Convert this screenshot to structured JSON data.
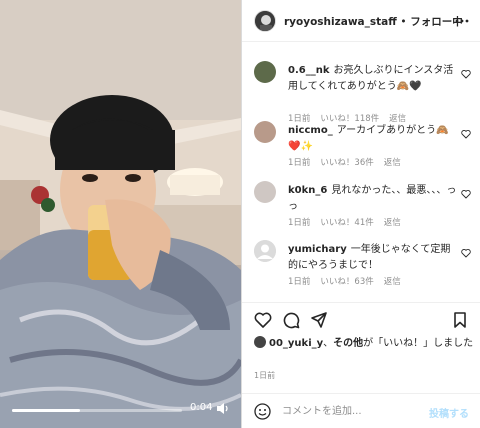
{
  "video": {
    "time": "0:04",
    "progress": 0.4,
    "volume_icon": "volume-icon"
  },
  "header": {
    "username": "ryoyoshizawa_staff",
    "separator": "•",
    "follow_status": "フォロー中",
    "more_icon": "more-icon"
  },
  "comments": [
    {
      "user": "0.6__nk",
      "text": "お亮久しぶりにインスタ活用してくれてありがとう🙈🖤",
      "time": "1日前",
      "likes": "いいね！118件",
      "reply": "返信"
    },
    {
      "user": "niccmo_",
      "text": "アーカイブありがとう🙈❤️✨",
      "time": "1日前",
      "likes": "いいね！36件",
      "reply": "返信"
    },
    {
      "user": "k0kn_6",
      "text": "見れなかった、、最悪、、、っっ",
      "time": "1日前",
      "likes": "いいね！41件",
      "reply": "返信"
    },
    {
      "user": "yumichary",
      "text": "一年後じゃなくて定期的にやろうまじで！",
      "time": "1日前",
      "likes": "いいね！63件",
      "reply": "返信"
    }
  ],
  "actions": {
    "like_icon": "heart-icon",
    "comment_icon": "comment-icon",
    "share_icon": "send-icon",
    "save_icon": "bookmark-icon"
  },
  "likes_line": {
    "liker": "00_yuki_y",
    "connector": "、",
    "others": "その他",
    "suffix": "が「いいね！」しました"
  },
  "post_date": "1日前",
  "comment_bar": {
    "placeholder": "コメントを追加...",
    "post_label": "投稿する"
  }
}
